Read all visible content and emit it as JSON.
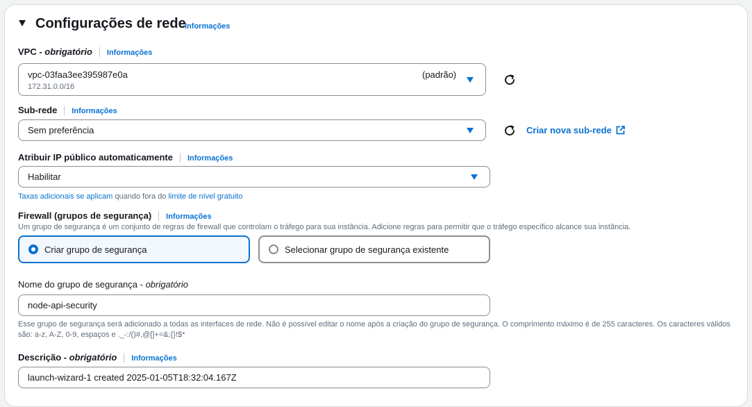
{
  "section": {
    "title": "Configurações de rede",
    "info": "Informações"
  },
  "vpc": {
    "label": "VPC",
    "required": "obrigatório",
    "info": "Informações",
    "value": "vpc-03faa3ee395987e0a",
    "cidr": "172.31.0.0/16",
    "tag": "(padrão)"
  },
  "subnet": {
    "label": "Sub-rede",
    "info": "Informações",
    "value": "Sem preferência",
    "create_link": "Criar nova sub-rede"
  },
  "public_ip": {
    "label": "Atribuir IP público automaticamente",
    "info": "Informações",
    "value": "Habilitar",
    "hint_link1": "Taxas adicionais se aplicam",
    "hint_mid": " quando fora do ",
    "hint_link2": "limite de nível gratuito"
  },
  "firewall": {
    "label": "Firewall (grupos de segurança)",
    "info": "Informações",
    "description": "Um grupo de segurança é um conjunto de regras de firewall que controlam o tráfego para sua instância. Adicione regras para permitir que o tráfego específico alcance sua instância.",
    "option_create": "Criar grupo de segurança",
    "option_select": "Selecionar grupo de segurança existente",
    "selected": "create"
  },
  "sg_name": {
    "label": "Nome do grupo de segurança",
    "required": "obrigatório",
    "value": "node-api-security",
    "hint": "Esse grupo de segurança será adicionado a todas as interfaces de rede. Não é possível editar o nome após a criação do grupo de segurança. O comprimento máximo é de 255 caracteres. Os caracteres válidos são: a-z, A-Z, 0-9, espaços e ._-:/()#,@[]+=&;{}!$*"
  },
  "description": {
    "label": "Descrição",
    "required": "obrigatório",
    "info": "Informações",
    "value": "launch-wizard-1 created 2025-01-05T18:32:04.167Z"
  },
  "colors": {
    "accent": "#0972d3",
    "selected_bg": "#f2f8fd"
  }
}
